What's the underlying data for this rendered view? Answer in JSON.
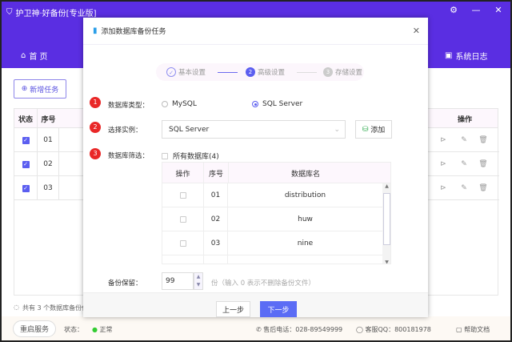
{
  "app": {
    "title": "护卫神·好备份[专业版]",
    "nav_home": "首 页",
    "nav_log": "系统日志",
    "new_task": "新增任务"
  },
  "main_table": {
    "headers": [
      "状态",
      "序号",
      "操作"
    ],
    "rows": [
      {
        "no": "01",
        "checked": true
      },
      {
        "no": "02",
        "checked": true
      },
      {
        "no": "03",
        "checked": true
      }
    ]
  },
  "summary": "共有 3 个数据库备份任",
  "footer": {
    "restart": "重启服务",
    "status_label": "状态：",
    "status_value": "正常",
    "phone": "售后电话：028-89549999",
    "qq": "客服QQ：800181978",
    "help": "帮助文档"
  },
  "dialog": {
    "title": "添加数据库备份任务",
    "steps": [
      {
        "num": "1",
        "label": "基本设置",
        "state": "done"
      },
      {
        "num": "2",
        "label": "高级设置",
        "state": "active"
      },
      {
        "num": "3",
        "label": "存储设置",
        "state": "pending"
      }
    ],
    "db_type": {
      "label": "数据库类型：",
      "options": [
        "MySQL",
        "SQL Server"
      ],
      "selected": "SQL Server"
    },
    "instance": {
      "label": "选择实例：",
      "value": "SQL Server",
      "add": "添加"
    },
    "filter": {
      "label": "数据库筛选：",
      "all": "所有数据库(4)",
      "headers": [
        "操作",
        "序号",
        "数据库名"
      ],
      "rows": [
        {
          "no": "01",
          "name": "distribution"
        },
        {
          "no": "02",
          "name": "huw"
        },
        {
          "no": "03",
          "name": "nine"
        }
      ]
    },
    "retain": {
      "label": "备份保留：",
      "value": "99",
      "hint": "份（输入 0 表示不删除备份文件）"
    },
    "prev": "上一步",
    "next": "下一步"
  },
  "colors": {
    "brand": "#5a2ee2",
    "accent": "#5b6cf5",
    "badge": "#e92727"
  }
}
